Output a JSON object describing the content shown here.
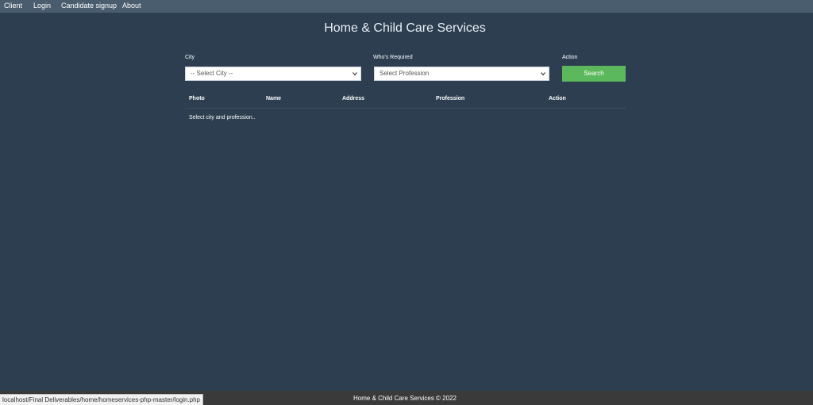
{
  "nav": {
    "items": [
      {
        "label": "Client"
      },
      {
        "label": "Login"
      },
      {
        "label": "Candidate signup"
      },
      {
        "label": "About"
      }
    ]
  },
  "header": {
    "title": "Home & Child Care Services"
  },
  "search_form": {
    "city_label": "City",
    "city_value": "-- Select City --",
    "profession_label": "Who's Required",
    "profession_value": "Select Profession",
    "action_label": "Action",
    "search_button": "Search"
  },
  "results_table": {
    "columns": [
      "Photo",
      "Name",
      "Address",
      "Profession",
      "Action"
    ],
    "empty_message": "Select city and profession.."
  },
  "footer": {
    "text": "Home & Child Care Services © 2022"
  },
  "status_bar": {
    "url": "localhost/Final Deliverables/home/homeservices-php-master/login.php"
  },
  "colors": {
    "background": "#2c3e50",
    "nav_background": "#4a5d6f",
    "search_button": "#5cb85c",
    "footer_background": "#3a3a3a"
  },
  "icons": {
    "select_arrow": "chevron-down-icon"
  }
}
